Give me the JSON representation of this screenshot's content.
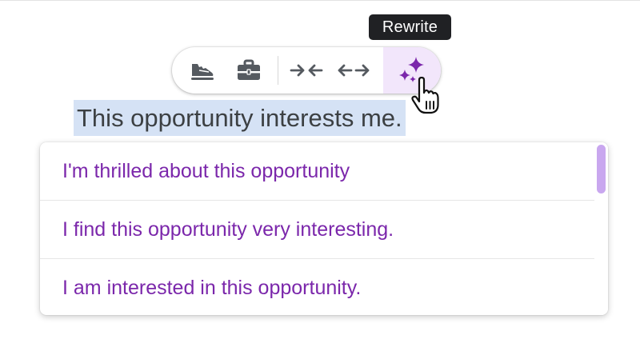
{
  "tooltip": {
    "label": "Rewrite"
  },
  "toolbar": {
    "buttons": [
      {
        "name": "casual-tone",
        "icon": "sneaker-icon"
      },
      {
        "name": "formal-tone",
        "icon": "briefcase-icon"
      },
      {
        "name": "shorten",
        "icon": "arrows-inward-icon"
      },
      {
        "name": "elaborate",
        "icon": "arrows-outward-icon"
      },
      {
        "name": "rewrite",
        "icon": "sparkle-icon"
      }
    ],
    "accent_color": "#7b27ab",
    "active_background": "#f2e6fb"
  },
  "editor": {
    "selected_text": "This opportunity interests me."
  },
  "suggestions": {
    "items": [
      {
        "text": "I'm thrilled about this opportunity"
      },
      {
        "text": "I find this opportunity very interesting."
      },
      {
        "text": "I am interested in this opportunity."
      }
    ],
    "text_color": "#7b27ab",
    "scrollbar_color": "#c9a7ef",
    "scroll_position": 0
  },
  "pointer": {
    "icon": "hand-pointer-icon"
  }
}
